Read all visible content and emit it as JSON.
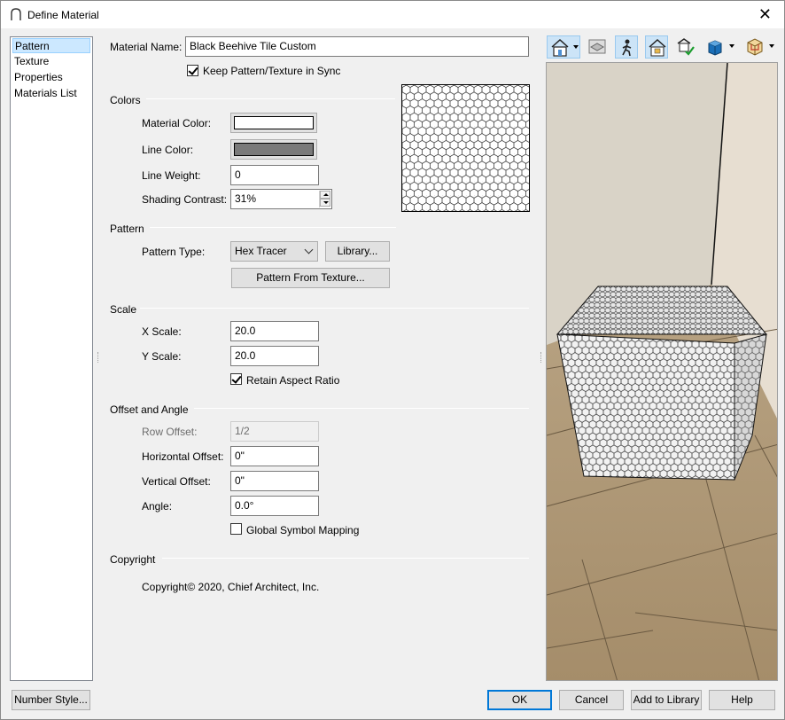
{
  "window": {
    "title": "Define Material",
    "close_glyph": "✕"
  },
  "nav": {
    "items": [
      {
        "label": "Pattern",
        "selected": true
      },
      {
        "label": "Texture",
        "selected": false
      },
      {
        "label": "Properties",
        "selected": false
      },
      {
        "label": "Materials List",
        "selected": false
      }
    ]
  },
  "material": {
    "name_label": "Material Name:",
    "name_value": "Black Beehive Tile Custom",
    "sync_label": "Keep Pattern/Texture in Sync",
    "sync_checked": true
  },
  "colors": {
    "section": "Colors",
    "material_color_label": "Material Color:",
    "material_color": "#ffffff",
    "line_color_label": "Line Color:",
    "line_color": "#7a7a7a",
    "line_weight_label": "Line Weight:",
    "line_weight_value": "0",
    "shading_contrast_label": "Shading Contrast:",
    "shading_contrast_value": "31%"
  },
  "pattern": {
    "section": "Pattern",
    "type_label": "Pattern Type:",
    "type_value": "Hex Tracer",
    "library_button": "Library...",
    "from_texture_button": "Pattern From Texture..."
  },
  "scale": {
    "section": "Scale",
    "x_label": "X Scale:",
    "x_value": "20.0",
    "y_label": "Y Scale:",
    "y_value": "20.0",
    "retain_label": "Retain Aspect Ratio",
    "retain_checked": true
  },
  "offset": {
    "section": "Offset and Angle",
    "row_offset_label": "Row Offset:",
    "row_offset_value": "1/2",
    "horizontal_label": "Horizontal Offset:",
    "horizontal_value": "0\"",
    "vertical_label": "Vertical Offset:",
    "vertical_value": "0\"",
    "angle_label": "Angle:",
    "angle_value": "0.0°",
    "global_mapping_label": "Global Symbol Mapping",
    "global_mapping_checked": false
  },
  "copyright": {
    "section": "Copyright",
    "text": "Copyright© 2020, Chief Architect, Inc."
  },
  "toolbar": {
    "icons": [
      "room-view-icon",
      "layers-icon",
      "camera-walk-icon",
      "house-check-icon",
      "library-check-icon",
      "cube-icon",
      "box-frame-icon"
    ]
  },
  "footer": {
    "number_style": "Number Style...",
    "ok": "OK",
    "cancel": "Cancel",
    "add_to_library": "Add to Library",
    "help": "Help"
  },
  "colors_ui": {
    "accent": "#0078d7",
    "selection_bg": "#cce8ff",
    "floor_wood": "#b39d7c",
    "wall_back": "#d9d3c7",
    "wall_right": "#e6ddd0"
  }
}
